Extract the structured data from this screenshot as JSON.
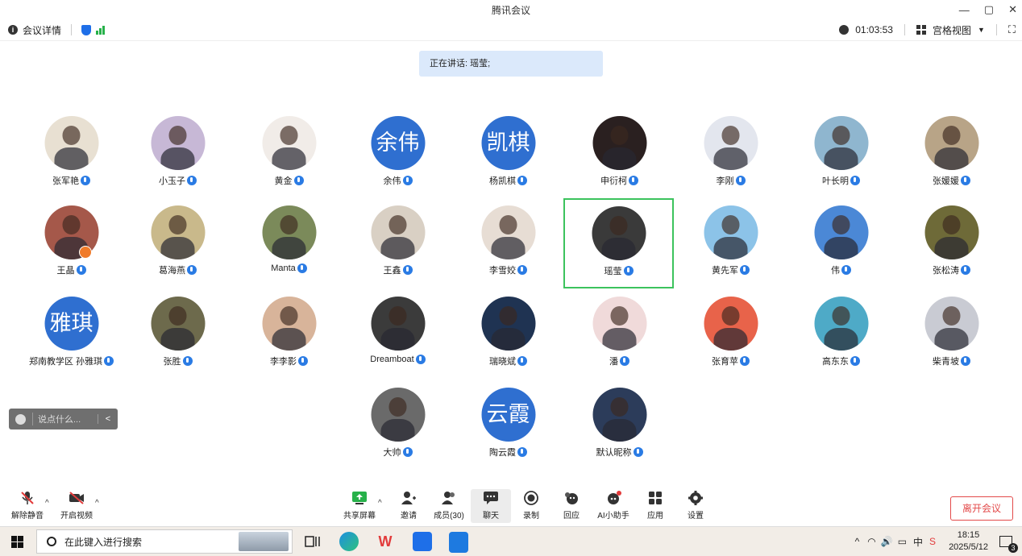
{
  "window": {
    "title": "腾讯会议",
    "controls": [
      "—",
      "▢",
      "✕"
    ]
  },
  "toolbar": {
    "meeting_info": "会议详情",
    "duration": "01:03:53",
    "view_mode": "宫格视图"
  },
  "speaking_banner": "正在讲话: 瑶莹;",
  "participants": [
    {
      "name": "张军艳",
      "avatar": "photo"
    },
    {
      "name": "小玉子",
      "avatar": "photo"
    },
    {
      "name": "黄金",
      "avatar": "photo"
    },
    {
      "name": "余伟",
      "avatar": "text",
      "avatar_text": "余伟"
    },
    {
      "name": "杨凯棋",
      "avatar": "text",
      "avatar_text": "凯棋"
    },
    {
      "name": "申衍柯",
      "avatar": "photo"
    },
    {
      "name": "李刚",
      "avatar": "photo"
    },
    {
      "name": "叶长明",
      "avatar": "photo"
    },
    {
      "name": "张媛媛",
      "avatar": "photo"
    },
    {
      "name": "王晶",
      "avatar": "photo",
      "host": true
    },
    {
      "name": "葛海燕",
      "avatar": "photo"
    },
    {
      "name": "Manta",
      "avatar": "photo"
    },
    {
      "name": "王鑫",
      "avatar": "photo"
    },
    {
      "name": "李雪姣",
      "avatar": "photo"
    },
    {
      "name": "瑶莹",
      "avatar": "photo",
      "speaking": true
    },
    {
      "name": "黄先军",
      "avatar": "photo"
    },
    {
      "name": "伟",
      "avatar": "photo"
    },
    {
      "name": "张松涛",
      "avatar": "photo"
    },
    {
      "name": "郑南教学区 孙雅琪",
      "avatar": "text",
      "avatar_text": "雅琪"
    },
    {
      "name": "张胜",
      "avatar": "photo"
    },
    {
      "name": "李李影",
      "avatar": "photo"
    },
    {
      "name": "Dreamboat",
      "avatar": "photo"
    },
    {
      "name": "瑞晓斌",
      "avatar": "photo"
    },
    {
      "name": "潘",
      "avatar": "photo"
    },
    {
      "name": "张育苹",
      "avatar": "photo"
    },
    {
      "name": "高东东",
      "avatar": "photo"
    },
    {
      "name": "柴青坡",
      "avatar": "photo"
    },
    {
      "name": "大帅",
      "avatar": "photo"
    },
    {
      "name": "陶云霞",
      "avatar": "text",
      "avatar_text": "云霞"
    },
    {
      "name": "默认昵称",
      "avatar": "photo"
    }
  ],
  "avatar_colors": [
    "#e8e0d2",
    "#c7b8d6",
    "#f1ece8",
    "#2f6fd0",
    "#2f6fd0",
    "#2a2020",
    "#e3e6ee",
    "#8fb6cf",
    "#b8a487",
    "#a5584a",
    "#c9b98b",
    "#7b8a5a",
    "#d9d0c4",
    "#e7ddd4",
    "#3a3a3a",
    "#8cc3e8",
    "#4b88d6",
    "#6e6a38",
    "#2f6fd0",
    "#6d6a4c",
    "#d8b49a",
    "#3b3b3b",
    "#1f3352",
    "#f0dada",
    "#e8634a",
    "#4eaac7",
    "#c9cbd3",
    "#6a6a6a",
    "#2f6fd0",
    "#2c3c5a"
  ],
  "chat": {
    "placeholder": "说点什么...",
    "collapse": "<"
  },
  "bottom_controls": {
    "unmute": "解除静音",
    "start_video": "开启视频",
    "share_screen": "共享屏幕",
    "invite": "邀请",
    "members": "成员(30)",
    "chat": "聊天",
    "record": "录制",
    "reactions": "回应",
    "ai_assistant": "AI小助手",
    "apps": "应用",
    "settings": "设置",
    "leave": "离开会议"
  },
  "taskbar": {
    "search_placeholder": "在此键入进行搜索",
    "ime_lang": "中",
    "time": "18:15",
    "date": "2025/5/12",
    "notifications": "3"
  }
}
